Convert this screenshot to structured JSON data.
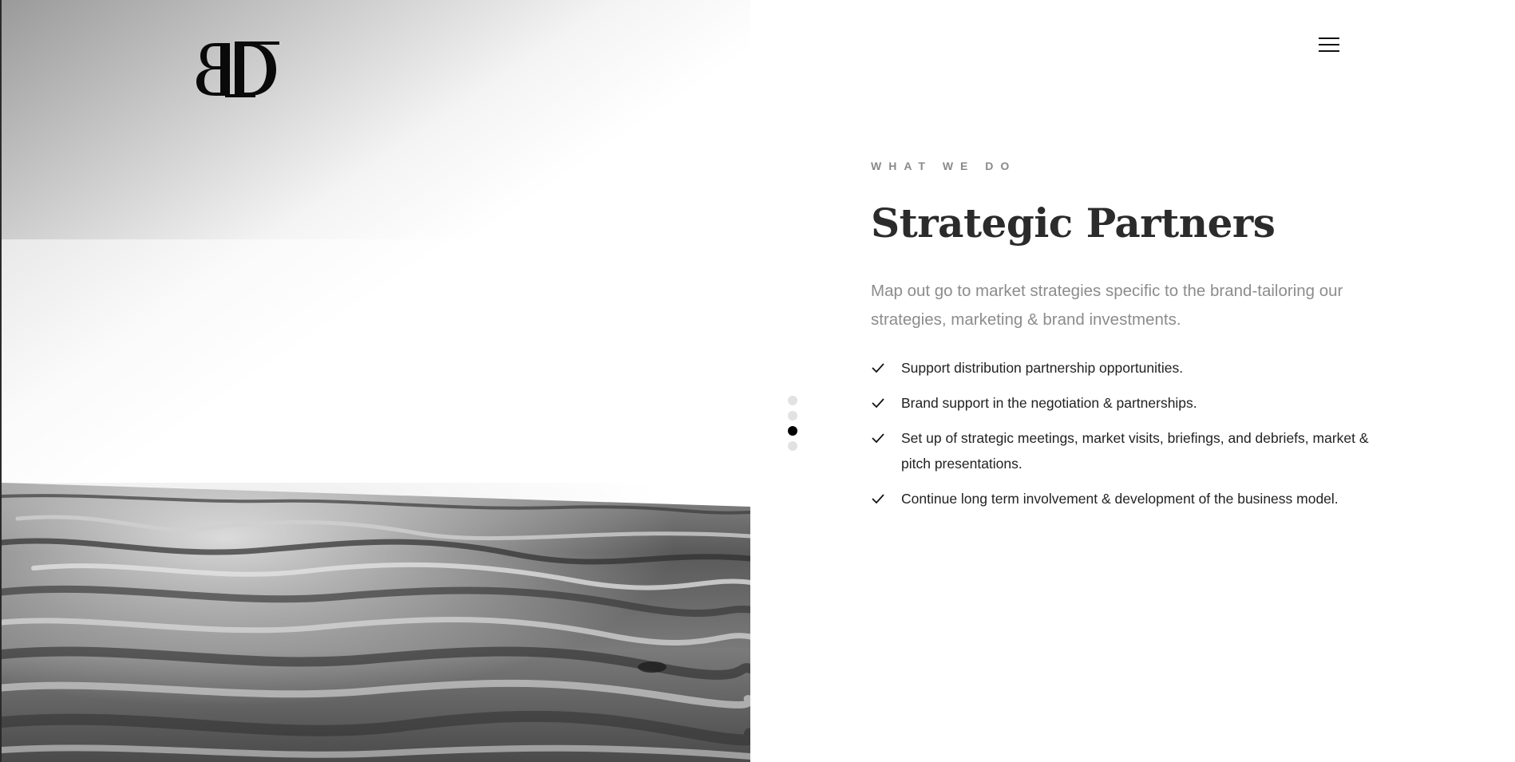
{
  "brand": {
    "logo_text": "BD"
  },
  "header": {
    "menu_icon": "hamburger-menu-icon"
  },
  "slider": {
    "slide_count": 4,
    "active_index": 2
  },
  "section": {
    "eyebrow": "WHAT WE DO",
    "title": "Strategic Partners",
    "lead": "Map out go to market strategies specific to the brand-tailoring our strategies, marketing & brand investments.",
    "items": [
      {
        "icon": "checkmark-icon",
        "text": "Support distribution partnership opportunities."
      },
      {
        "icon": "checkmark-icon",
        "text": "Brand support in the negotiation & partnerships."
      },
      {
        "icon": "checkmark-icon",
        "text": "Set up of strategic meetings, market visits, briefings, and debriefs, market & pitch presentations."
      },
      {
        "icon": "checkmark-icon",
        "text": "Continue long term involvement & development of the business model."
      }
    ]
  },
  "colors": {
    "text_dark": "#2b2b2b",
    "text_muted": "#8c8c8c",
    "dot_inactive": "#e2e2e2",
    "dot_active": "#000000"
  }
}
